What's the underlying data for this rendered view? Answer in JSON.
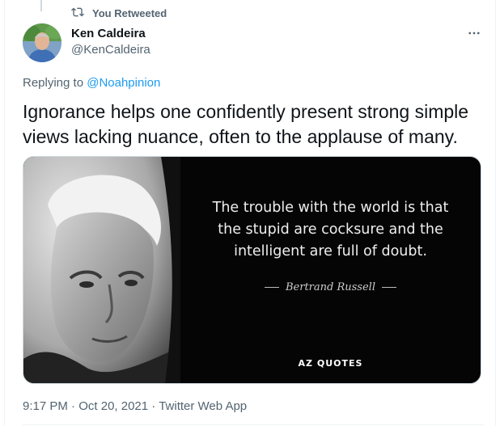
{
  "retweet": {
    "icon": "retweet-icon",
    "label": "You Retweeted"
  },
  "author": {
    "name": "Ken Caldeira",
    "handle": "@KenCaldeira",
    "avatar_icon": "avatar-photo"
  },
  "more_icon": "more-icon",
  "reply": {
    "prefix": "Replying to ",
    "target": "@Noahpinion"
  },
  "tweet": {
    "text": "Ignorance helps one confidently present strong simple views lacking nuance, often to the applause of many."
  },
  "media": {
    "quote_lines": [
      "The trouble with the world is that",
      "the stupid are cocksure and the",
      "intelligent are full of doubt."
    ],
    "author": "Bertrand Russell",
    "brand": "AZ QUOTES"
  },
  "meta": {
    "time": "9:17 PM",
    "separator": " · ",
    "date": "Oct 20, 2021",
    "source": "Twitter Web App"
  },
  "colors": {
    "link": "#1d9bf0",
    "muted": "#536471",
    "text": "#0f1419"
  }
}
